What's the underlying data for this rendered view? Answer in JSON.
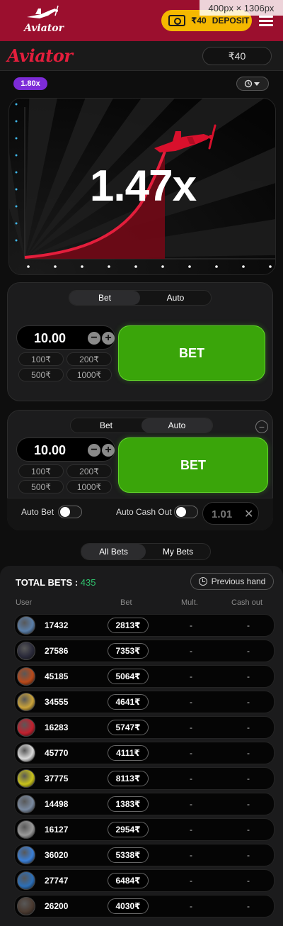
{
  "header": {
    "logo_text": "Aviator",
    "deposit": {
      "amount": "₹40",
      "label": "DEPOSIT"
    },
    "size_tip": "400px × 1306px"
  },
  "subheader": {
    "title": "Aviator",
    "balance": "₹40"
  },
  "game": {
    "current_multiplier": "1.47x",
    "previous_multipliers": [
      "1.80x"
    ]
  },
  "panels": [
    {
      "tabs": [
        "Bet",
        "Auto"
      ],
      "active_tab": "Bet",
      "amount": "10.00",
      "minus": "−",
      "plus": "+",
      "quick_amounts": [
        "100₹",
        "200₹",
        "500₹",
        "1000₹"
      ],
      "bet_label": "BET"
    },
    {
      "tabs": [
        "Bet",
        "Auto"
      ],
      "active_tab": "Auto",
      "amount": "10.00",
      "minus": "−",
      "plus": "+",
      "quick_amounts": [
        "100₹",
        "200₹",
        "500₹",
        "1000₹"
      ],
      "bet_label": "BET",
      "auto_bet_label": "Auto Bet",
      "auto_cashout_label": "Auto Cash Out",
      "auto_cashout_value": "1.01",
      "clear_symbol": "✕",
      "remove_symbol": "−"
    }
  ],
  "bets_list": {
    "tabs": [
      "All Bets",
      "My Bets"
    ],
    "active_tab": "All Bets",
    "total_label": "TOTAL BETS :",
    "total_count": "435",
    "previous_hand_label": "Previous hand",
    "columns": [
      "User",
      "Bet",
      "Mult.",
      "Cash out"
    ],
    "rows": [
      {
        "user": "17432",
        "bet": "2813₹",
        "mult": "-",
        "cashout": "-",
        "avatar_color": "#5a7ea8"
      },
      {
        "user": "27586",
        "bet": "7353₹",
        "mult": "-",
        "cashout": "-",
        "avatar_color": "#2a2a3a"
      },
      {
        "user": "45185",
        "bet": "5064₹",
        "mult": "-",
        "cashout": "-",
        "avatar_color": "#b8491a"
      },
      {
        "user": "34555",
        "bet": "4641₹",
        "mult": "-",
        "cashout": "-",
        "avatar_color": "#c9a23a"
      },
      {
        "user": "16283",
        "bet": "5747₹",
        "mult": "-",
        "cashout": "-",
        "avatar_color": "#c2202e"
      },
      {
        "user": "45770",
        "bet": "4111₹",
        "mult": "-",
        "cashout": "-",
        "avatar_color": "#d9d9d9"
      },
      {
        "user": "37775",
        "bet": "8113₹",
        "mult": "-",
        "cashout": "-",
        "avatar_color": "#c8c21a"
      },
      {
        "user": "14498",
        "bet": "1383₹",
        "mult": "-",
        "cashout": "-",
        "avatar_color": "#7a8aa0"
      },
      {
        "user": "16127",
        "bet": "2954₹",
        "mult": "-",
        "cashout": "-",
        "avatar_color": "#9a9a9a"
      },
      {
        "user": "36020",
        "bet": "5338₹",
        "mult": "-",
        "cashout": "-",
        "avatar_color": "#3b7fd6"
      },
      {
        "user": "27747",
        "bet": "6484₹",
        "mult": "-",
        "cashout": "-",
        "avatar_color": "#2c6fb8"
      },
      {
        "user": "26200",
        "bet": "4030₹",
        "mult": "-",
        "cashout": "-",
        "avatar_color": "#4a3a30"
      }
    ]
  },
  "colors": {
    "brand_red": "#e41e3c",
    "topbar": "#9b0f2e",
    "deposit_yellow": "#f5b800",
    "bet_green": "#3aa50a",
    "badge_purple": "#7d2bd8",
    "count_green": "#30c06c"
  },
  "icons": [
    "aviator-logo-icon",
    "cash-icon",
    "menu-icon",
    "history-icon",
    "plane-icon",
    "clock-icon",
    "avatar-icons"
  ]
}
